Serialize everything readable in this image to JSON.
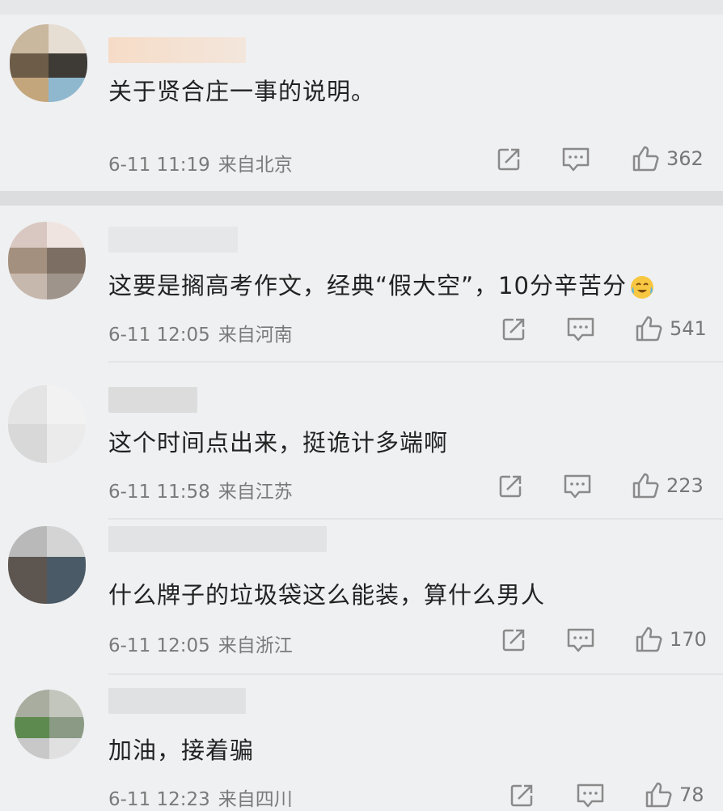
{
  "comments": [
    {
      "text": "关于贤合庄一事的说明。",
      "date": "6-11 11:19",
      "location": "来自北京",
      "likes": "362"
    },
    {
      "text": "这要是搁高考作文，经典“假大空”，10分辛苦分",
      "date": "6-11 12:05",
      "location": "来自河南",
      "likes": "541"
    },
    {
      "text": "这个时间点出来，挺诡计多端啊",
      "date": "6-11 11:58",
      "location": "来自江苏",
      "likes": "223"
    },
    {
      "text": "什么牌子的垃圾袋这么能装，算什么男人",
      "date": "6-11 12:05",
      "location": "来自浙江",
      "likes": "170"
    },
    {
      "text": "加油，接着骗",
      "date": "6-11 12:23",
      "location": "来自四川",
      "likes": "78"
    }
  ],
  "icons": {
    "share": "share-icon",
    "reply": "comment-icon",
    "like": "thumbs-up-icon",
    "emoji": "crying-laughing-emoji"
  },
  "colors": {
    "background": "#eff0f2",
    "text": "#222222",
    "meta": "#7a7a7a",
    "icon": "#8a8a8a"
  }
}
